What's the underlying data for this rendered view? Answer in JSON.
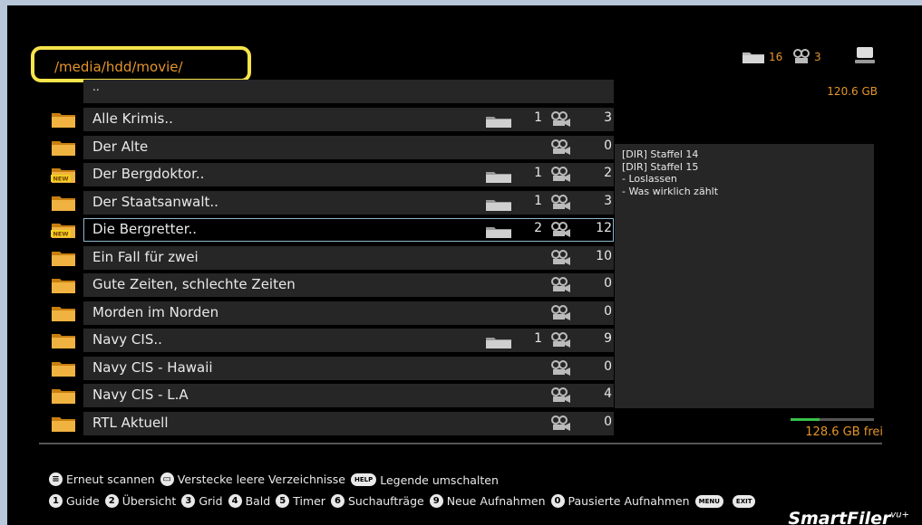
{
  "path": "/media/hdd/movie/",
  "stats": {
    "folders": "16",
    "files": "3"
  },
  "disk_size": "120.6 GB",
  "parent_dir": "..",
  "rows": [
    {
      "name": "Alle Krimis..",
      "new": false,
      "subfolders": "1",
      "files": "3",
      "selected": false
    },
    {
      "name": "Der Alte",
      "new": false,
      "subfolders": "",
      "files": "0",
      "selected": false
    },
    {
      "name": "Der Bergdoktor..",
      "new": true,
      "subfolders": "1",
      "files": "2",
      "selected": false
    },
    {
      "name": "Der Staatsanwalt..",
      "new": false,
      "subfolders": "1",
      "files": "3",
      "selected": false
    },
    {
      "name": "Die Bergretter..",
      "new": true,
      "subfolders": "2",
      "files": "12",
      "selected": true
    },
    {
      "name": "Ein Fall für zwei",
      "new": false,
      "subfolders": "",
      "files": "10",
      "selected": false
    },
    {
      "name": "Gute Zeiten, schlechte Zeiten",
      "new": false,
      "subfolders": "",
      "files": "0",
      "selected": false
    },
    {
      "name": "Morden im Norden",
      "new": false,
      "subfolders": "",
      "files": "0",
      "selected": false
    },
    {
      "name": "Navy CIS..",
      "new": false,
      "subfolders": "1",
      "files": "9",
      "selected": false
    },
    {
      "name": "Navy CIS - Hawaii",
      "new": false,
      "subfolders": "",
      "files": "0",
      "selected": false
    },
    {
      "name": "Navy CIS - L.A",
      "new": false,
      "subfolders": "",
      "files": "4",
      "selected": false
    },
    {
      "name": "RTL Aktuell",
      "new": false,
      "subfolders": "",
      "files": "0",
      "selected": false
    }
  ],
  "preview": [
    "[DIR] Staffel 14",
    "[DIR] Staffel 15",
    " - Loslassen",
    " - Was wirklich zählt"
  ],
  "free_space": "128.6 GB frei",
  "free_fraction": 0.35,
  "legend_line1": [
    {
      "key": "≡",
      "type": "circle",
      "label": "Erneut scannen"
    },
    {
      "key": "▭",
      "type": "circle",
      "label": "Verstecke leere Verzeichnisse"
    },
    {
      "key": "HELP",
      "type": "pill",
      "label": "Legende umschalten"
    }
  ],
  "legend_line2": [
    {
      "key": "1",
      "type": "circle",
      "label": "Guide"
    },
    {
      "key": "2",
      "type": "circle",
      "label": "Übersicht"
    },
    {
      "key": "3",
      "type": "circle",
      "label": "Grid"
    },
    {
      "key": "4",
      "type": "circle",
      "label": "Bald"
    },
    {
      "key": "5",
      "type": "circle",
      "label": "Timer"
    },
    {
      "key": "6",
      "type": "circle",
      "label": "Suchaufträge"
    },
    {
      "key": "9",
      "type": "circle",
      "label": "Neue Aufnahmen"
    },
    {
      "key": "0",
      "type": "circle",
      "label": "Pausierte Aufnahmen"
    },
    {
      "key": "MENU",
      "type": "pill",
      "label": ""
    },
    {
      "key": "EXIT",
      "type": "pill",
      "label": ""
    }
  ],
  "brand": {
    "name": "SmartFiler",
    "sup": "vu+"
  },
  "colors": {
    "accent": "#e3952a",
    "highlight": "#f5e44a",
    "row_bg": "#262626",
    "free_bar": "#38c24a"
  }
}
